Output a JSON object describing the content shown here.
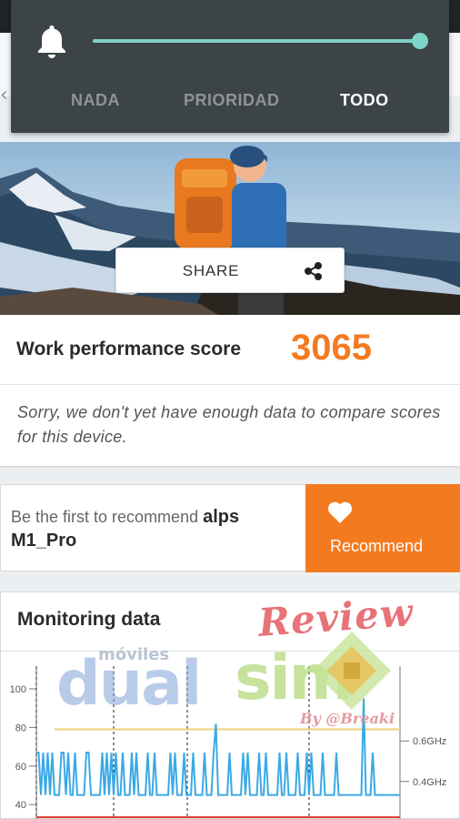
{
  "notification_panel": {
    "tabs": [
      {
        "label": "NADA",
        "active": false
      },
      {
        "label": "PRIORIDAD",
        "active": false
      },
      {
        "label": "TODO",
        "active": true
      }
    ],
    "volume_level": 1.0,
    "icon": "bell-icon",
    "accent_color": "#7ed2c7"
  },
  "hero": {
    "share_label": "SHARE",
    "share_icon": "share-icon"
  },
  "score": {
    "title": "Work performance score",
    "value": "3065",
    "value_color": "#f47a20",
    "note": "Sorry, we don't yet have enough data to compare scores for this device."
  },
  "recommend": {
    "prefix": "Be the first to recommend ",
    "device_name": "alps M1_Pro",
    "button_label": "Recommend",
    "button_icon": "heart-icon",
    "button_color": "#f47a20"
  },
  "monitoring": {
    "title": "Monitoring data"
  },
  "watermark": {
    "review": "Review",
    "moviles": "móviles",
    "dual": "dual",
    "sim": "sim",
    "by": "By @Breaki"
  },
  "chart_data": {
    "type": "line",
    "y_ticks": [
      "100",
      "80",
      "60",
      "40"
    ],
    "right_ticks": [
      "0.6GHz",
      "0.4GHz"
    ],
    "ylim": [
      30,
      110
    ],
    "series": [
      {
        "color": "#3aa9e6",
        "values": [
          67,
          67,
          45,
          67,
          45,
          67,
          45,
          67,
          45,
          45,
          45,
          67,
          67,
          45,
          67,
          45,
          45,
          67,
          45,
          45,
          45,
          45,
          67,
          67,
          45,
          45,
          45,
          45,
          45,
          67,
          45,
          67,
          45,
          67,
          45,
          67,
          45,
          45,
          67,
          45,
          45,
          45,
          67,
          45,
          67,
          45,
          45,
          45,
          45,
          67,
          45,
          45,
          67,
          45,
          45,
          45,
          45,
          45,
          45,
          67,
          45,
          67,
          45,
          45,
          45,
          67,
          45,
          45,
          45,
          67,
          45,
          45,
          45,
          45,
          67,
          45,
          45,
          45,
          67,
          82,
          45,
          45,
          45,
          45,
          45,
          67,
          45,
          45,
          45,
          45,
          45,
          67,
          45,
          67,
          45,
          45,
          45,
          45,
          67,
          45,
          45,
          67,
          45,
          45,
          45,
          45,
          45,
          67,
          45,
          45,
          67,
          45,
          45,
          45,
          45,
          67,
          45,
          45,
          45,
          67,
          45,
          67,
          45,
          45,
          45,
          45,
          67,
          45,
          45,
          45,
          45,
          45,
          67,
          45,
          45,
          45,
          45,
          45,
          45,
          45,
          45,
          45,
          45,
          45,
          95,
          45,
          45,
          45,
          67,
          45,
          45,
          45,
          45,
          45,
          45,
          45,
          45,
          45,
          45,
          45,
          45
        ]
      }
    ],
    "reference_lines": [
      {
        "y": 79,
        "color": "#e8d27a"
      }
    ]
  }
}
